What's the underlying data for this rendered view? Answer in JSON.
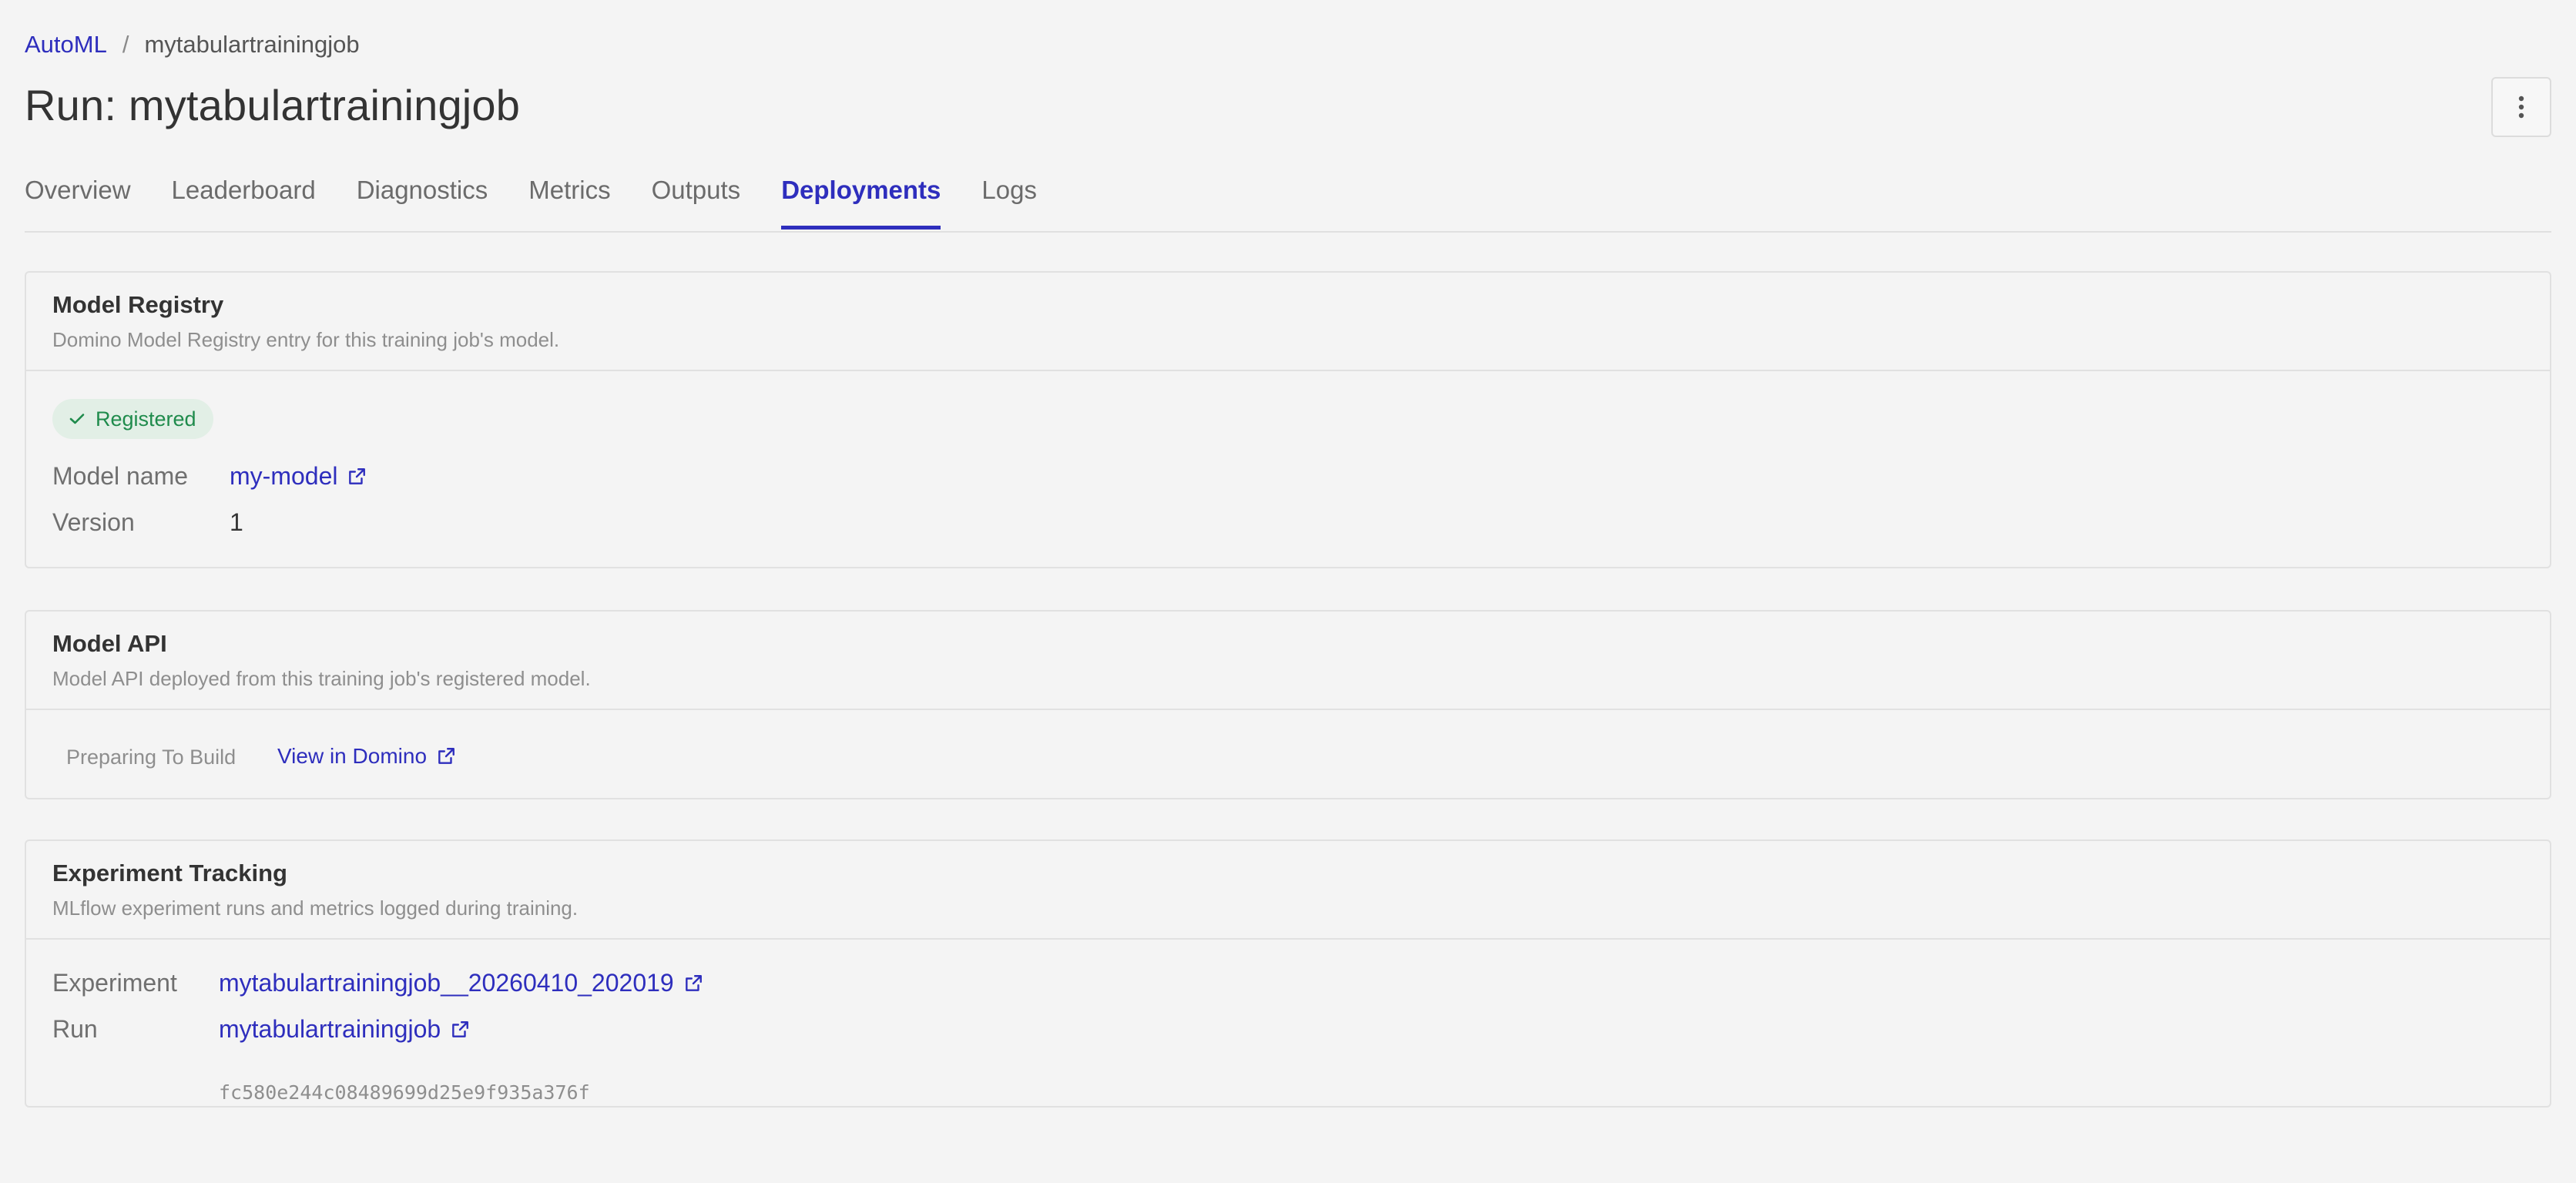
{
  "breadcrumb": {
    "root": "AutoML",
    "separator": "/",
    "current": "mytabulartrainingjob"
  },
  "page": {
    "title": "Run: mytabulartrainingjob"
  },
  "menu": {
    "icon": "more-vertical-icon"
  },
  "tabs": [
    {
      "label": "Overview",
      "active": false
    },
    {
      "label": "Leaderboard",
      "active": false
    },
    {
      "label": "Diagnostics",
      "active": false
    },
    {
      "label": "Metrics",
      "active": false
    },
    {
      "label": "Outputs",
      "active": false
    },
    {
      "label": "Deployments",
      "active": true
    },
    {
      "label": "Logs",
      "active": false
    }
  ],
  "registry": {
    "title": "Model Registry",
    "subtitle": "Domino Model Registry entry for this training job's model.",
    "badge": "Registered",
    "model_name_label": "Model name",
    "model_name": "my-model",
    "version_label": "Version",
    "version": "1"
  },
  "model_api": {
    "title": "Model API",
    "subtitle": "Model API deployed from this training job's registered model.",
    "status": "Preparing To Build",
    "link_label": "View in Domino"
  },
  "tracking": {
    "title": "Experiment Tracking",
    "subtitle": "MLflow experiment runs and metrics logged during training.",
    "experiment_label": "Experiment",
    "experiment": "mytabulartrainingjob__20260410_202019",
    "run_label": "Run",
    "run": "mytabulartrainingjob",
    "run_id": "fc580e244c08489699d25e9f935a376f"
  },
  "colors": {
    "accent": "#2e2ebd",
    "success": "#1f8b4c",
    "success_bg": "#e2efe6"
  }
}
